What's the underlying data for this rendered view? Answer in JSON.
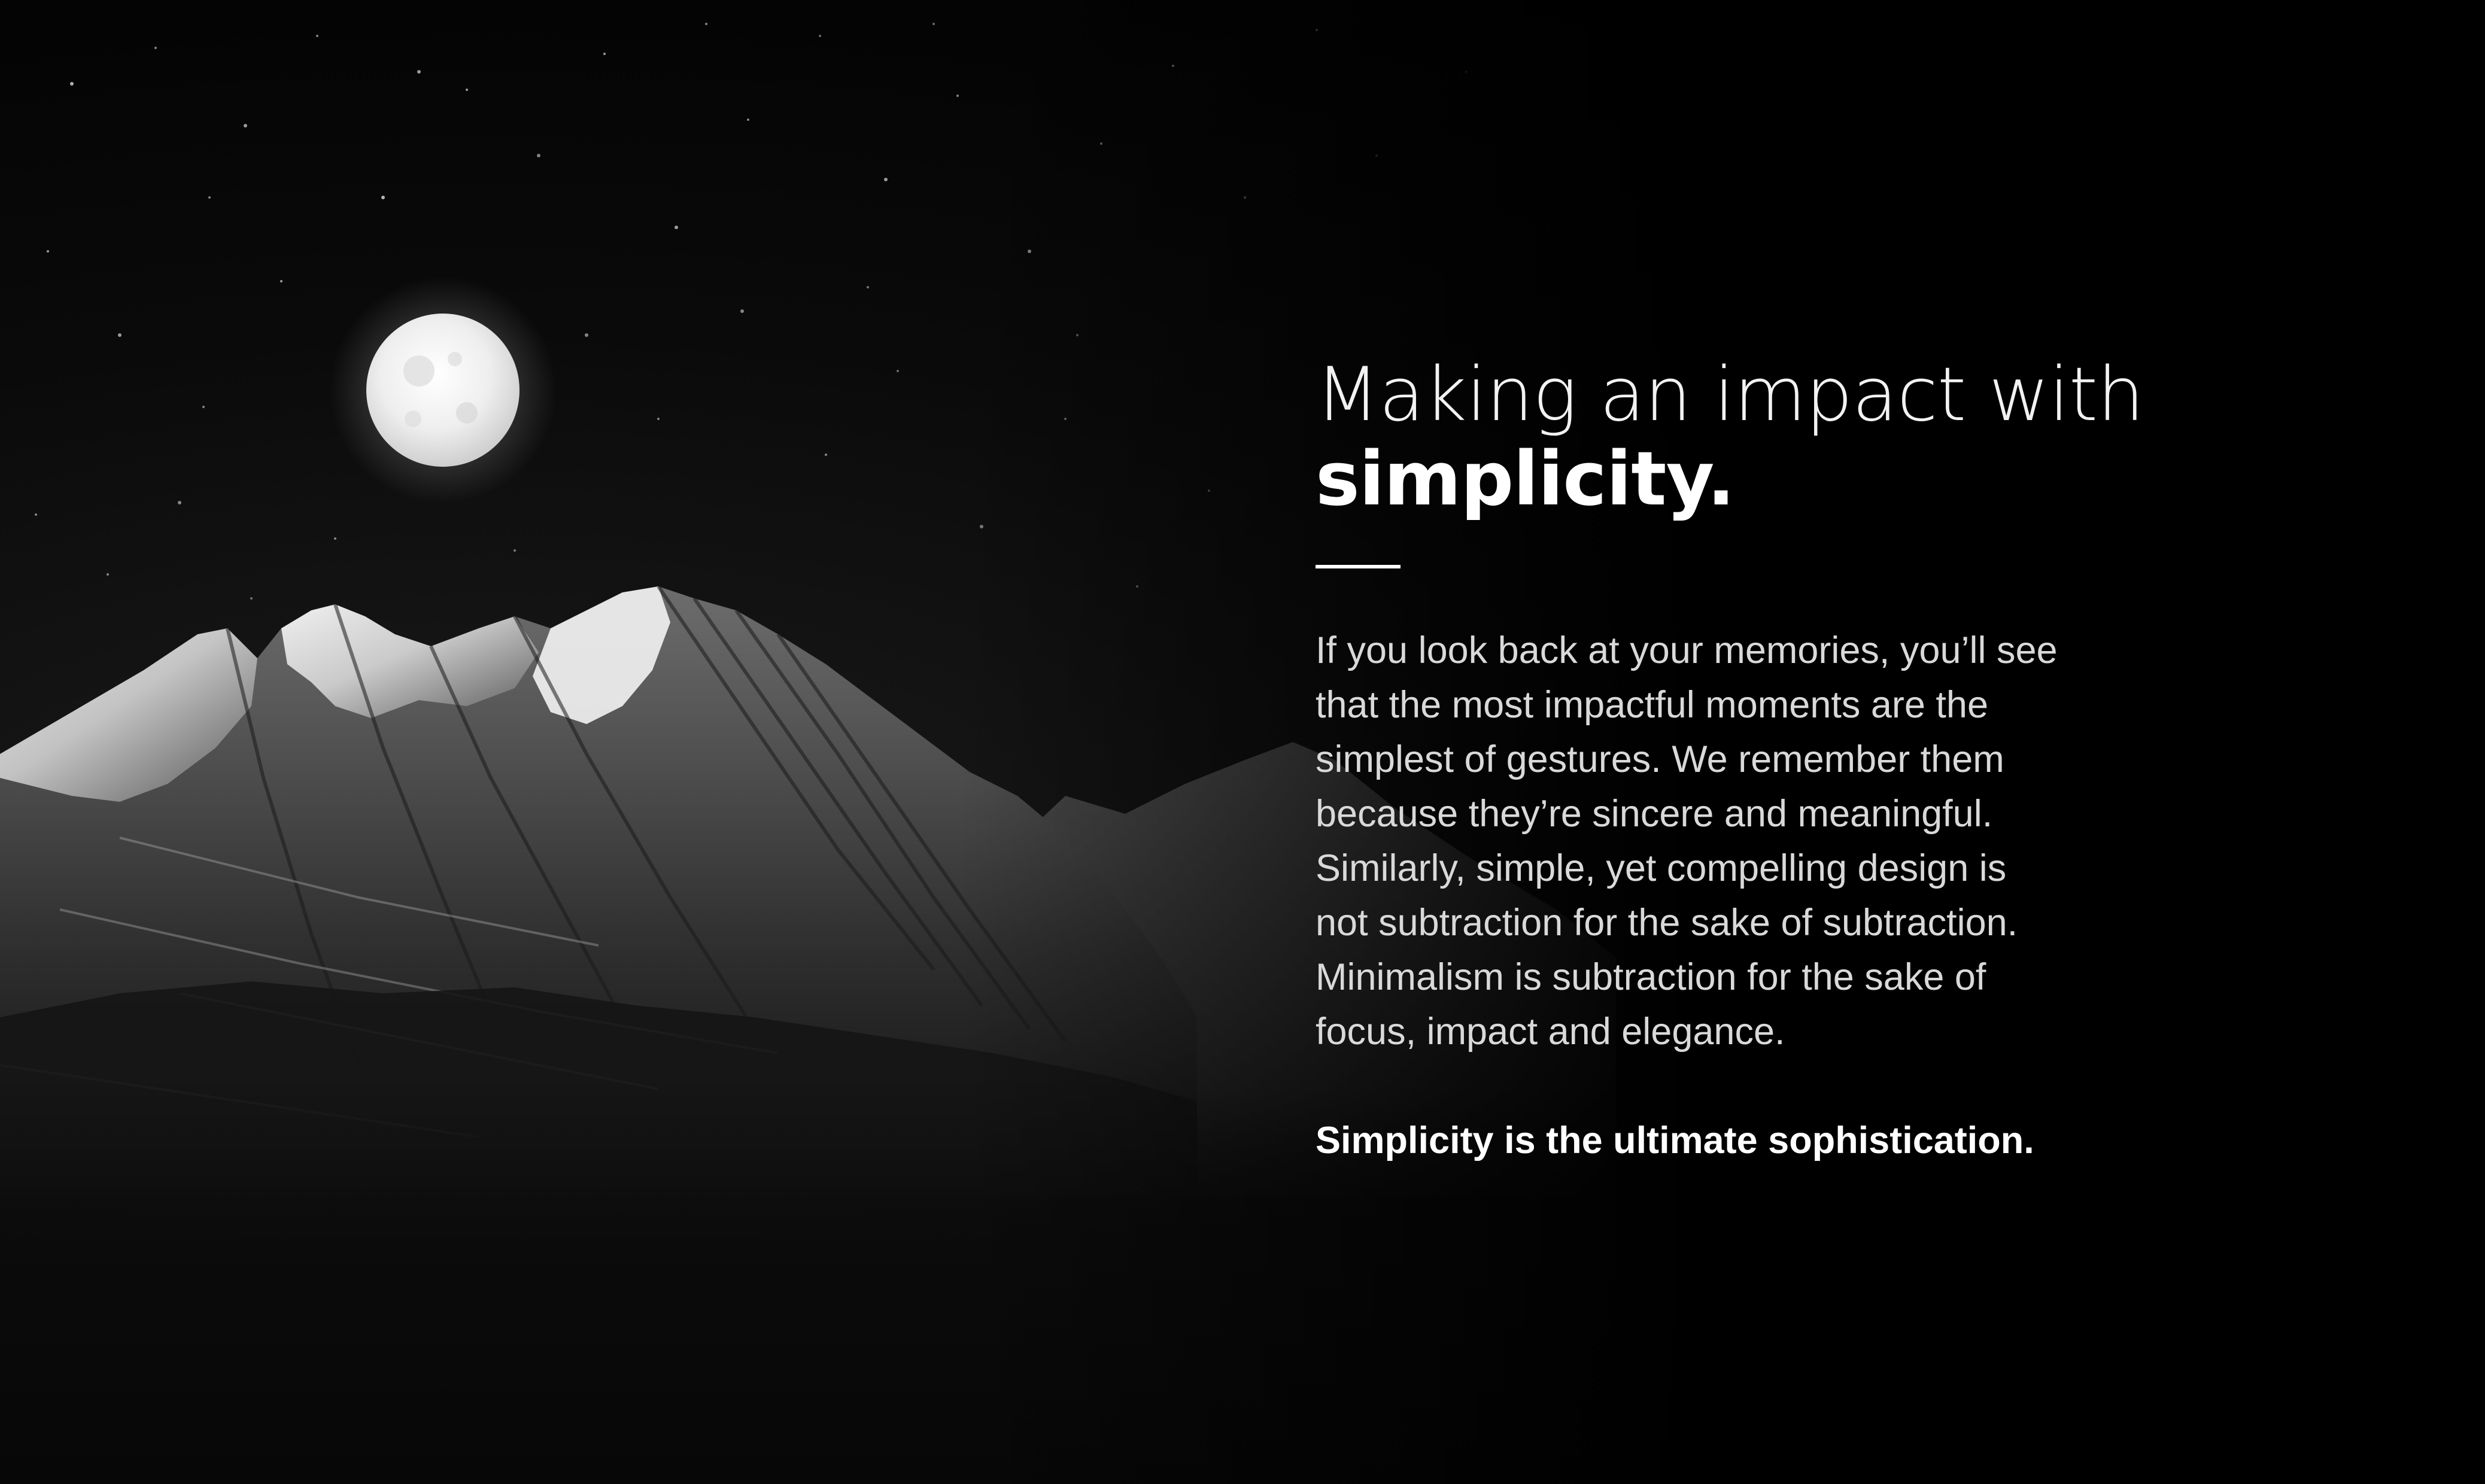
{
  "hero": {
    "image": {
      "description_icon": "moon-over-mountains-photo"
    },
    "headline": {
      "line1": "Making an impact with",
      "line2": "simplicity."
    },
    "body_lines": [
      "If you look back at your memories, you’ll see",
      "that the most impactful moments are the",
      "simplest of gestures. We remember them",
      "because they’re sincere and meaningful.",
      "Similarly, simple, yet compelling design is",
      "not subtraction for the sake of subtraction.",
      "Minimalism is subtraction for the sake of",
      "focus, impact and elegance."
    ],
    "tagline": "Simplicity is the ultimate sophistication."
  },
  "colors": {
    "background": "#050505",
    "text": "#ffffff",
    "body_text": "#d9d9d9"
  }
}
